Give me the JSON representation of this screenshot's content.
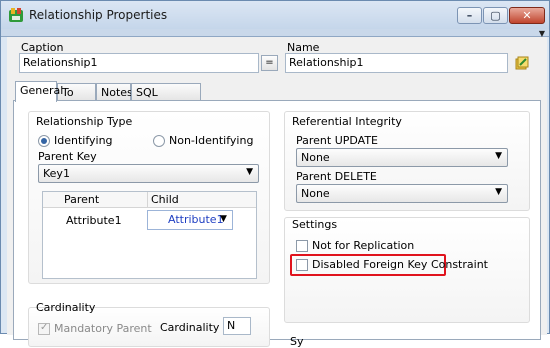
{
  "window": {
    "title": "Relationship Properties",
    "app_icon": "erd-app-icon"
  },
  "window_controls": {
    "minimize_icon": "minimize-icon",
    "maximize_icon": "maximize-icon",
    "close_icon": "close-icon"
  },
  "caption": {
    "label": "Caption",
    "value": "Relationship1",
    "equals_label": "="
  },
  "name": {
    "label": "Name",
    "value": "Relationship1",
    "side_icon": "edit-name-icon"
  },
  "tabs": [
    "General",
    "To Do",
    "Notes",
    "SQL Preview"
  ],
  "active_tab": "General",
  "relationship_type": {
    "title": "Relationship Type",
    "options": [
      "Identifying",
      "Non-Identifying"
    ],
    "selected": "Identifying"
  },
  "parent_key": {
    "label": "Parent Key",
    "value": "Key1"
  },
  "mapping_grid": {
    "headers": [
      "Parent",
      "Child"
    ],
    "rows": [
      {
        "parent": "Attribute1",
        "child": "Attribute1"
      }
    ]
  },
  "referential_integrity": {
    "title": "Referential Integrity",
    "parent_update_label": "Parent UPDATE",
    "parent_update_value": "None",
    "parent_delete_label": "Parent DELETE",
    "parent_delete_value": "None"
  },
  "settings": {
    "title": "Settings",
    "not_for_replication": "Not for Replication",
    "disabled_fk": "Disabled Foreign Key Constraint",
    "highlight_color": "#e0131d"
  },
  "cardinality": {
    "title": "Cardinality",
    "mandatory_parent": "Mandatory Parent",
    "cardinality_label": "Cardinality",
    "cardinality_value": "N"
  },
  "partial_label": "Sy"
}
